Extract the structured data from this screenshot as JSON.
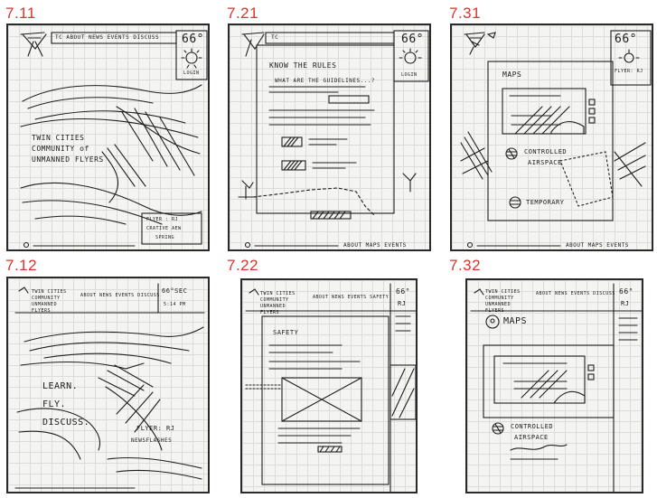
{
  "labels": [
    "7.11",
    "7.21",
    "7.31",
    "7.12",
    "7.22",
    "7.32"
  ],
  "s711": {
    "nav": "TC    ABOUT  NEWS  EVENTS  DISCUSS",
    "temp": "66°",
    "login": "LOGIN",
    "tagline_1": "TWIN CITIES",
    "tagline_2": "COMMUNITY of",
    "tagline_3": "UNMANNED FLYERS",
    "card_1": "FLYER : RJ",
    "card_2": "CRATIVE AEW",
    "card_3": "SPRING"
  },
  "s721": {
    "nav": "TC",
    "temp": "66°",
    "login": "LOGIN",
    "heading": "KNOW THE RULES",
    "question": "WHAT ARE THE GUIDELINES...?",
    "footer": "ABOUT  MAPS  EVENTS"
  },
  "s731": {
    "temp": "66°",
    "flyer": "FLYER: RJ",
    "maps": "MAPS",
    "controlled_1": "CONTROLLED",
    "controlled_2": "AIRSPACE",
    "temporary": "TEMPORARY",
    "footer": "ABOUT  MAPS  EVENTS"
  },
  "s712": {
    "logo": "TWIN CITIES COMMUNITY UNMANNED FLYERS",
    "nav": "ABOUT  NEWS  EVENTS  DISCUSS",
    "temp": "66°SEC",
    "time": "5:14 PM",
    "learn": "LEARN.",
    "fly": "FLY.",
    "discuss": "DISCUSS.",
    "flyer": "FLYER: RJ",
    "news": "NEWSFLASHES"
  },
  "s722": {
    "logo": "TWIN CITIES COMMUNITY UNMANNED FLYERS",
    "nav": "ABOUT  NEWS  EVENTS  SAFETY",
    "temp": "66°",
    "initials": "RJ",
    "safety": "SAFETY"
  },
  "s732": {
    "logo": "TWIN CITIES COMMUNITY UNMANNED FLYERS",
    "nav": "ABOUT  NEWS  EVENTS  DISCUSS",
    "temp": "66°",
    "initials": "RJ",
    "maps": "MAPS",
    "controlled_1": "CONTROLLED",
    "controlled_2": "AIRSPACE"
  }
}
